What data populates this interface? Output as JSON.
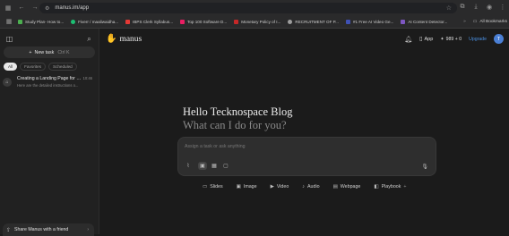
{
  "browser": {
    "url": "manus.im/app",
    "bookmarks": [
      {
        "label": "Study Plan- How to...",
        "color": "#4caf50"
      },
      {
        "label": "Fiverr / maaliwaidha...",
        "color": "#1dbf73"
      },
      {
        "label": "IBPS Clerk Syllabus...",
        "color": "#e53935"
      },
      {
        "label": "Top 100 Software D...",
        "color": "#e91e63"
      },
      {
        "label": "Monetary Policy of I...",
        "color": "#c62828"
      },
      {
        "label": "RECRUITMENT OF P...",
        "color": "#9e9e9e"
      },
      {
        "label": "#1 Free AI Video Ge...",
        "color": "#3f51b5"
      },
      {
        "label": "AI Content Detector...",
        "color": "#7e57c2"
      }
    ],
    "more_chevron": "»",
    "all_bookmarks_label": "All Bookmarks"
  },
  "sidebar": {
    "new_task_label": "New task",
    "new_task_shortcut": "Ctrl K",
    "filters": [
      "All",
      "Favorites",
      "Scheduled"
    ],
    "tasks": [
      {
        "title": "Creating a Landing Page for T...",
        "subtitle": "Here are the detailed instructions o...",
        "time": "10:46"
      }
    ],
    "share_label": "Share Manus with a friend"
  },
  "header": {
    "logo_text": "manus",
    "app_label": "App",
    "credits": "989 + 0",
    "upgrade_label": "Upgrade",
    "avatar_initial": "T"
  },
  "main": {
    "greeting": "Hello Tecknospace Blog",
    "prompt": "What can I do for you?",
    "composer_placeholder": "Assign a task or ask anything",
    "quick_actions": [
      {
        "label": "Slides",
        "icon": "slides-icon"
      },
      {
        "label": "Image",
        "icon": "image-icon"
      },
      {
        "label": "Video",
        "icon": "video-icon"
      },
      {
        "label": "Audio",
        "icon": "audio-icon"
      },
      {
        "label": "Webpage",
        "icon": "webpage-icon"
      },
      {
        "label": "Playbook",
        "icon": "playbook-icon"
      }
    ]
  }
}
